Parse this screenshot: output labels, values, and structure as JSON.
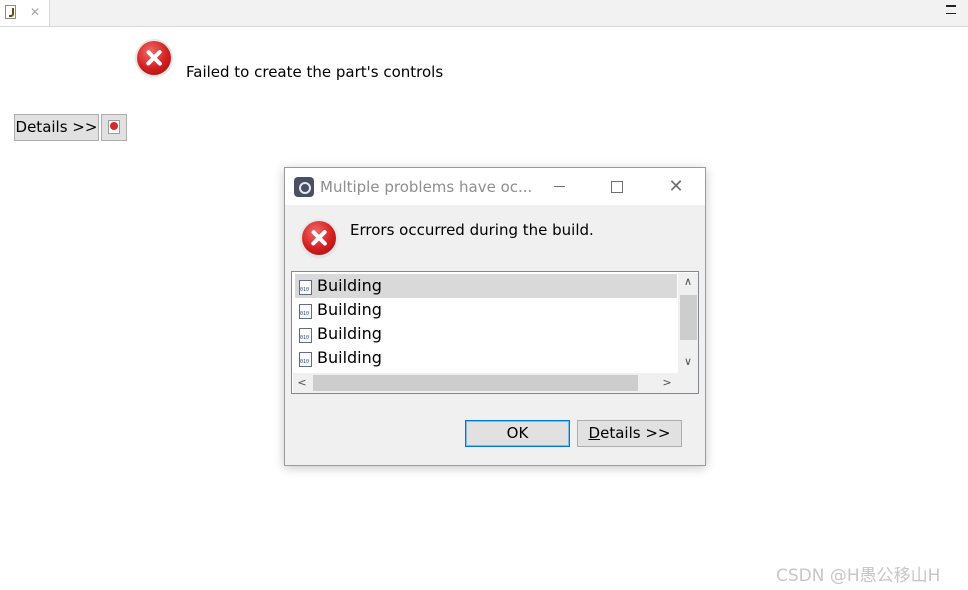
{
  "editor": {
    "tab": {
      "close_symbol": "✕",
      "icon": "java-file-icon"
    },
    "view_menu_icon": "view-menu-icon"
  },
  "error_part": {
    "message": "Failed to create the part's controls",
    "details_button": "Details >>",
    "icon": "error-icon"
  },
  "dialog": {
    "title": "Multiple problems have oc...",
    "minimize_symbol": "",
    "close_symbol": "✕",
    "message": "Errors occurred during the build.",
    "list_items": [
      {
        "label": "Building",
        "selected": true
      },
      {
        "label": "Building",
        "selected": false
      },
      {
        "label": "Building",
        "selected": false
      },
      {
        "label": "Building",
        "selected": false
      }
    ],
    "scroll_up": "∧",
    "scroll_down": "∨",
    "scroll_left": "<",
    "scroll_right": ">",
    "ok_label": "OK",
    "details_mnemonic": "D",
    "details_rest": "etails >>"
  },
  "watermark": "CSDN @H愚公移山H",
  "colors": {
    "error_red": "#d21f1f",
    "focus_blue": "#0078d7",
    "selection_gray": "#d9d9d9"
  }
}
